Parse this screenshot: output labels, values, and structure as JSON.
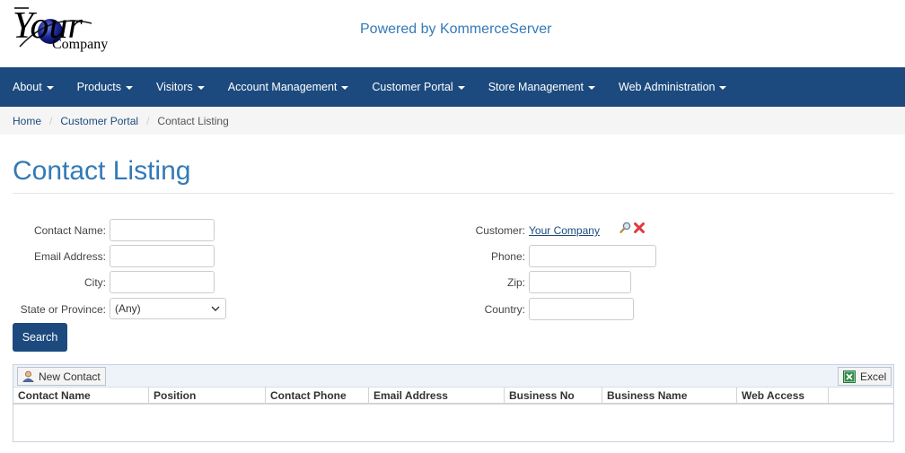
{
  "header": {
    "logo_word": "Your",
    "logo_company": "Company",
    "powered_by": "Powered by KommerceServer"
  },
  "nav": {
    "items": [
      {
        "label": "About"
      },
      {
        "label": "Products"
      },
      {
        "label": "Visitors"
      },
      {
        "label": "Account Management"
      },
      {
        "label": "Customer Portal"
      },
      {
        "label": "Store Management"
      },
      {
        "label": "Web Administration"
      }
    ]
  },
  "breadcrumb": {
    "home": "Home",
    "parent": "Customer Portal",
    "current": "Contact Listing",
    "separator": "/"
  },
  "page": {
    "title": "Contact Listing"
  },
  "form": {
    "contact_name_label": "Contact Name:",
    "contact_name_value": "",
    "email_label": "Email Address:",
    "email_value": "",
    "city_label": "City:",
    "city_value": "",
    "state_label": "State or Province:",
    "state_value": "(Any)",
    "customer_label": "Customer:",
    "customer_value": "Your Company",
    "phone_label": "Phone:",
    "phone_value": "",
    "zip_label": "Zip:",
    "zip_value": "",
    "country_label": "Country:",
    "country_value": "",
    "search_label": "Search"
  },
  "grid": {
    "new_contact_label": "New Contact",
    "excel_label": "Excel",
    "columns": [
      "Contact Name",
      "Position",
      "Contact Phone",
      "Email Address",
      "Business No",
      "Business Name",
      "Web Access"
    ],
    "rows": []
  },
  "colors": {
    "nav_bg": "#1c4a7e",
    "title": "#337ab7",
    "link": "#1c4a7e",
    "breadcrumb_bg": "#f5f5f5"
  }
}
